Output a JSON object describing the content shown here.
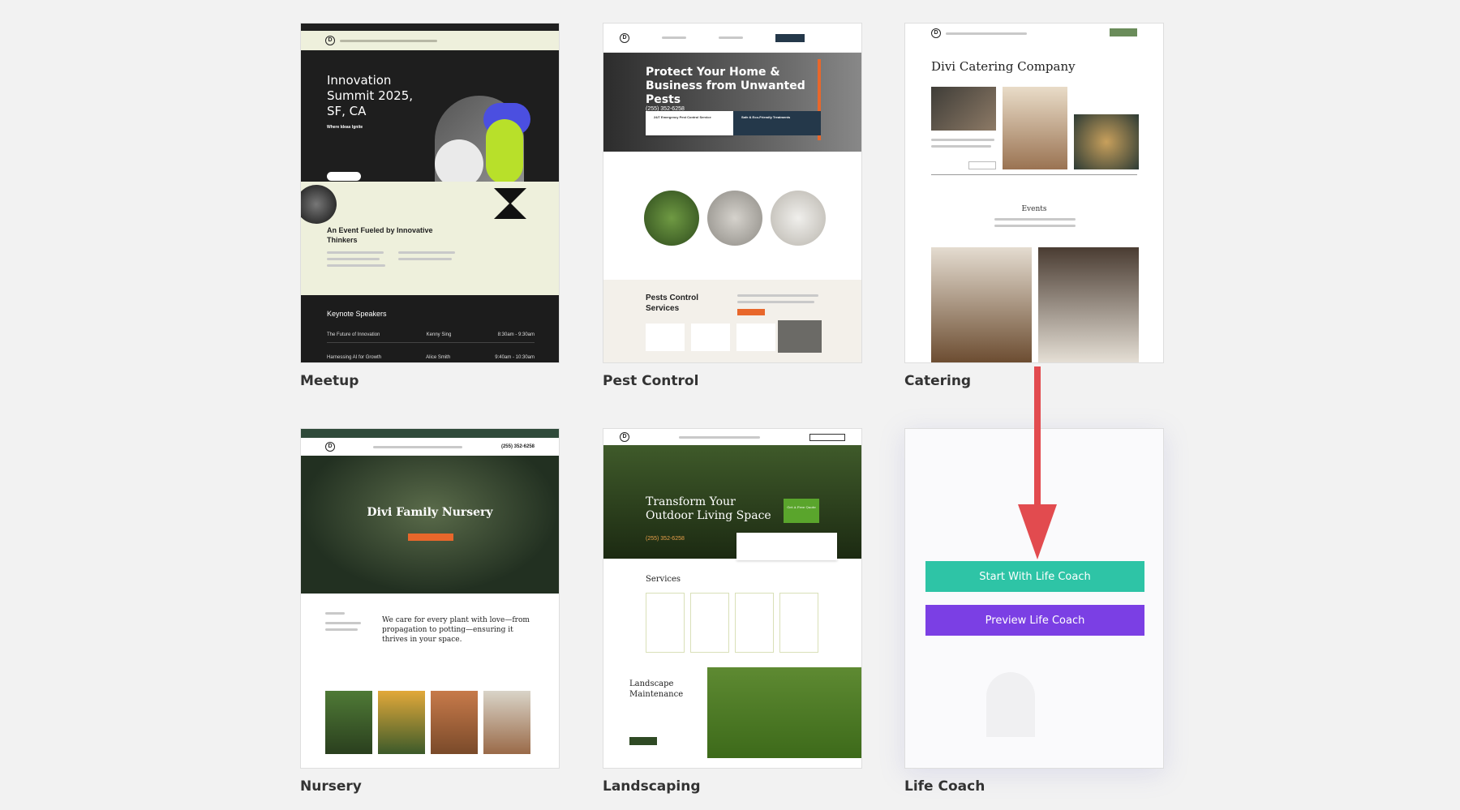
{
  "colors": {
    "start_button": "#2ec4a6",
    "preview_button": "#7b3fe4",
    "arrow": "#e24b4f",
    "page_bg": "#f2f2f2"
  },
  "layouts": [
    {
      "name": "Meetup",
      "preview": {
        "hero_title": "Innovation Summit 2025, SF, CA",
        "hero_tagline": "Where Ideas Ignite",
        "section_title": "An Event Fueled by Innovative Thinkers",
        "speakers_title": "Keynote Speakers",
        "rows": [
          {
            "talk": "The Future of Innovation",
            "speaker": "Kenny Sing",
            "time": "8:30am - 9:30am"
          },
          {
            "talk": "Harnessing AI for Growth",
            "speaker": "Alice Smith",
            "time": "9:40am - 10:30am"
          }
        ]
      }
    },
    {
      "name": "Pest Control",
      "preview": {
        "hero_title": "Protect Your Home & Business from Unwanted Pests",
        "phone": "(255) 352-6258",
        "box1": "24/7 Emergency Pest Control Service",
        "box2": "Safe & Eco-Friendly Treatments",
        "section_title": "Pests Control Services"
      }
    },
    {
      "name": "Catering",
      "preview": {
        "hero_title": "Divi Catering Company",
        "section_title": "Events"
      }
    },
    {
      "name": "Nursery",
      "preview": {
        "hero_title": "Divi Family Nursery",
        "phone": "(255) 352-6258",
        "quote": "We care for every plant with love—from propagation to potting—ensuring it thrives in your space."
      }
    },
    {
      "name": "Landscaping",
      "preview": {
        "hero_title": "Transform Your Outdoor Living Space",
        "cta": "Get A Free Quote",
        "phone": "(255) 352-6258",
        "services_title": "Services",
        "section_title": "Landscape Maintenance"
      }
    },
    {
      "name": "Life Coach",
      "actions": {
        "start_label": "Start With Life Coach",
        "preview_label": "Preview Life Coach"
      }
    }
  ]
}
